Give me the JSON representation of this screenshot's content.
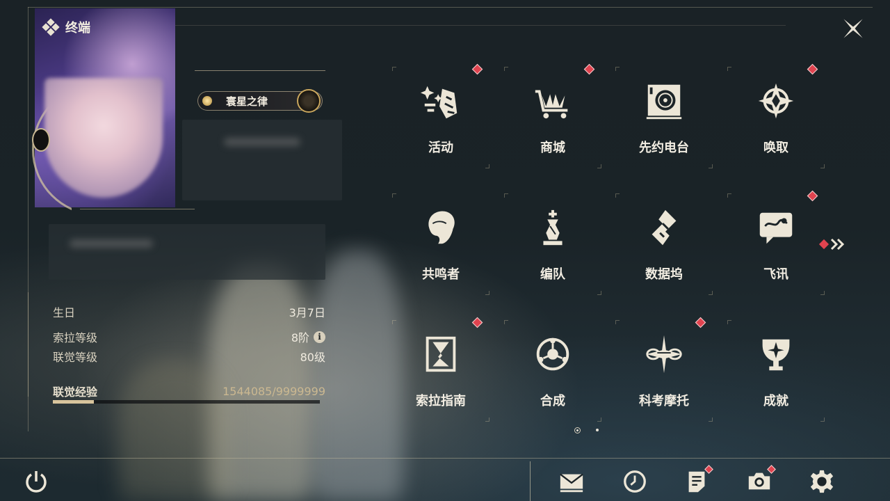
{
  "header": {
    "title": "终端"
  },
  "profile": {
    "title_badge": "寰星之律"
  },
  "stats": {
    "birthday": {
      "label": "生日",
      "value": "3月7日"
    },
    "sol_rank": {
      "label": "索拉等级",
      "value": "8阶"
    },
    "union_level": {
      "label": "联觉等级",
      "value": "80级"
    },
    "union_exp": {
      "label": "联觉经验",
      "value": "1544085/9999999",
      "progress": 0.154
    }
  },
  "menu": {
    "items": [
      {
        "label": "活动",
        "icon": "event-icon",
        "badge": true
      },
      {
        "label": "商城",
        "icon": "shop-icon",
        "badge": true
      },
      {
        "label": "先约电台",
        "icon": "radio-icon",
        "badge": false
      },
      {
        "label": "唤取",
        "icon": "convene-icon",
        "badge": true
      },
      {
        "label": "共鸣者",
        "icon": "resonator-icon",
        "badge": false
      },
      {
        "label": "编队",
        "icon": "team-icon",
        "badge": false
      },
      {
        "label": "数据坞",
        "icon": "data-bank-icon",
        "badge": false
      },
      {
        "label": "飞讯",
        "icon": "message-icon",
        "badge": true
      },
      {
        "label": "索拉指南",
        "icon": "guidebook-icon",
        "badge": true
      },
      {
        "label": "合成",
        "icon": "synthesis-icon",
        "badge": false
      },
      {
        "label": "科考摩托",
        "icon": "motorbike-icon",
        "badge": true
      },
      {
        "label": "成就",
        "icon": "achievement-icon",
        "badge": false
      }
    ],
    "page": {
      "current": 1,
      "total": 2
    }
  },
  "bottom_bar": {
    "buttons": [
      "power-icon",
      "mail-icon",
      "clock-icon",
      "notice-icon",
      "camera-icon",
      "settings-icon"
    ]
  },
  "colors": {
    "badge": "#e0434f",
    "accent": "#d8c49c",
    "text": "#f2ede2"
  }
}
